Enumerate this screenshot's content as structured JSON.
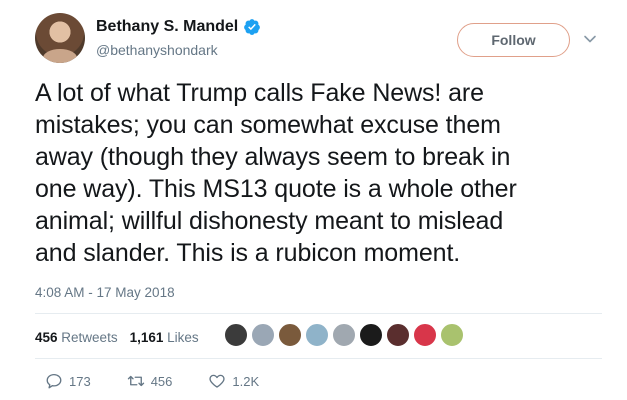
{
  "author": {
    "display_name": "Bethany S. Mandel",
    "handle": "@bethanyshondark",
    "verified": true
  },
  "follow_label": "Follow",
  "tweet_lines": [
    "A lot of what Trump calls Fake News! are",
    "mistakes; you can somewhat excuse them",
    "away (though they always seem to break in",
    "one way). This MS13 quote is a whole other",
    "animal; willful dishonesty meant to mislead",
    "and slander. This is a rubicon moment."
  ],
  "timestamp": "4:08 AM - 17 May 2018",
  "stats": {
    "retweets_count": "456",
    "retweets_label": "Retweets",
    "likes_count": "1,161",
    "likes_label": "Likes"
  },
  "liker_avatars": [
    {
      "color": "#3b3b3b"
    },
    {
      "color": "#9aa7b5"
    },
    {
      "color": "#7a5a3c"
    },
    {
      "color": "#8fb3c9"
    },
    {
      "color": "#a0a8b0"
    },
    {
      "color": "#1b1b1b"
    },
    {
      "color": "#5a2e2e"
    },
    {
      "color": "#d8364a"
    },
    {
      "color": "#a9c26e"
    }
  ],
  "actions": {
    "reply_count": "173",
    "retweet_count": "456",
    "like_count": "1.2K"
  },
  "colors": {
    "verified_blue": "#1da1f2",
    "secondary_text": "#657786",
    "divider": "#e6ecf0"
  }
}
